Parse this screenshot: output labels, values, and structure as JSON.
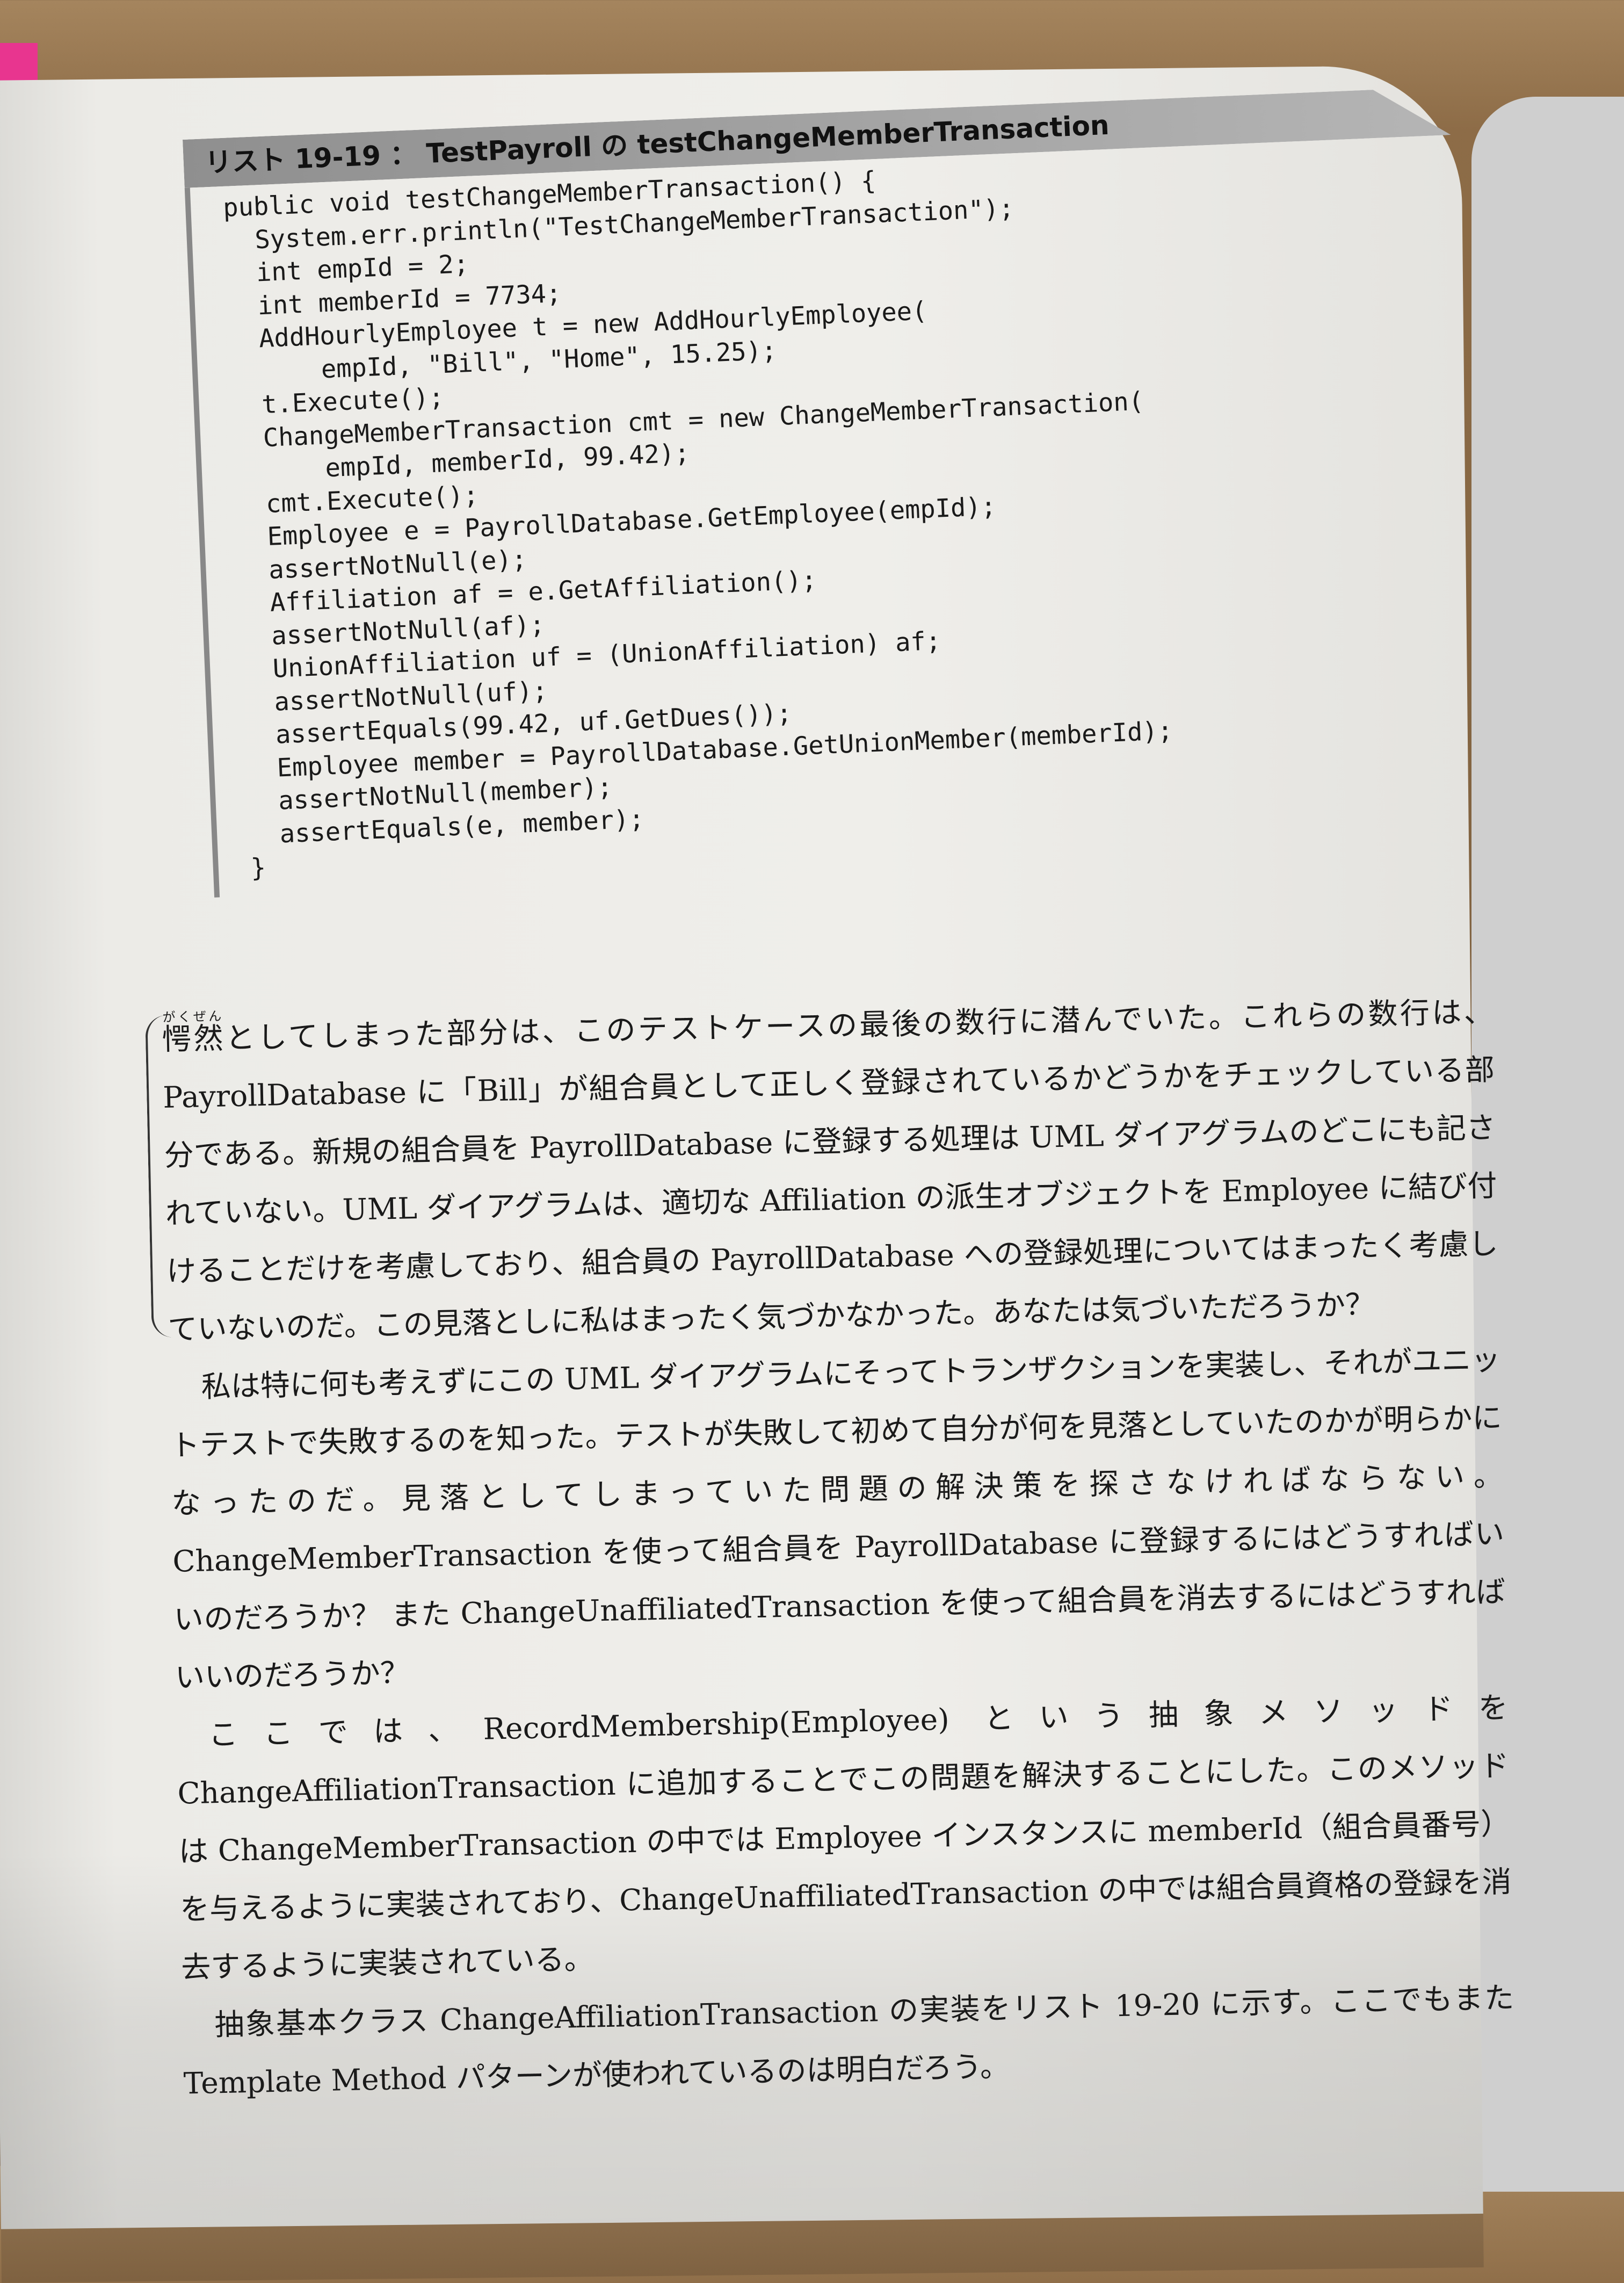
{
  "listing": {
    "title": "リスト 19-19 ： TestPayroll の testChangeMemberTransaction",
    "code_lines": [
      "public void testChangeMemberTransaction() {",
      "  System.err.println(\"TestChangeMemberTransaction\");",
      "  int empId = 2;",
      "  int memberId = 7734;",
      "  AddHourlyEmployee t = new AddHourlyEmployee(",
      "      empId, \"Bill\", \"Home\", 15.25);",
      "  t.Execute();",
      "  ChangeMemberTransaction cmt = new ChangeMemberTransaction(",
      "      empId, memberId, 99.42);",
      "  cmt.Execute();",
      "  Employee e = PayrollDatabase.GetEmployee(empId);",
      "  assertNotNull(e);",
      "  Affiliation af = e.GetAffiliation();",
      "  assertNotNull(af);",
      "  UnionAffiliation uf = (UnionAffiliation) af;",
      "  assertNotNull(uf);",
      "  assertEquals(99.42, uf.GetDues());",
      "  Employee member = PayrollDatabase.GetUnionMember(memberId);",
      "  assertNotNull(member);",
      "  assertEquals(e, member);",
      "}"
    ]
  },
  "text": {
    "p1_ruby_base": "愕然",
    "p1_ruby_reading": "がくぜん",
    "p1_rest": "としてしまった部分は、このテストケースの最後の数行に潜んでいた。これらの数行は、PayrollDatabase に「Bill」が組合員として正しく登録されているかどうかをチェックしている部分である。新規の組合員を PayrollDatabase に登録する処理は UML ダイアグラムのどこにも記されていない。UML ダイアグラムは、適切な Affiliation の派生オブジェクトを Employee に結び付けることだけを考慮しており、組合員の PayrollDatabase への登録処理についてはまったく考慮していないのだ。この見落としに私はまったく気づかなかった。あなたは気づいただろうか？",
    "p2": "私は特に何も考えずにこの UML ダイアグラムにそってトランザクションを実装し、それがユニットテストで失敗するのを知った。テストが失敗して初めて自分が何を見落としていたのかが明らかになったのだ。見落としてしまっていた問題の解決策を探さなければならない。ChangeMemberTransaction を使って組合員を PayrollDatabase に登録するにはどうすればいいのだろうか？ また ChangeUnaffiliatedTransaction を使って組合員を消去するにはどうすればいいのだろうか？",
    "p3": "ここでは、RecordMembership(Employee) という抽象メソッドを ChangeAffiliationTransaction に追加することでこの問題を解決することにした。このメソッドは ChangeMemberTransaction の中では Employee インスタンスに memberId（組合員番号）を与えるように実装されており、ChangeUnaffiliatedTransaction の中では組合員資格の登録を消去するように実装されている。",
    "p4": "抽象基本クラス ChangeAffiliationTransaction の実装をリスト 19-20 に示す。ここでもまた Template Method パターンが使われているのは明白だろう。"
  }
}
